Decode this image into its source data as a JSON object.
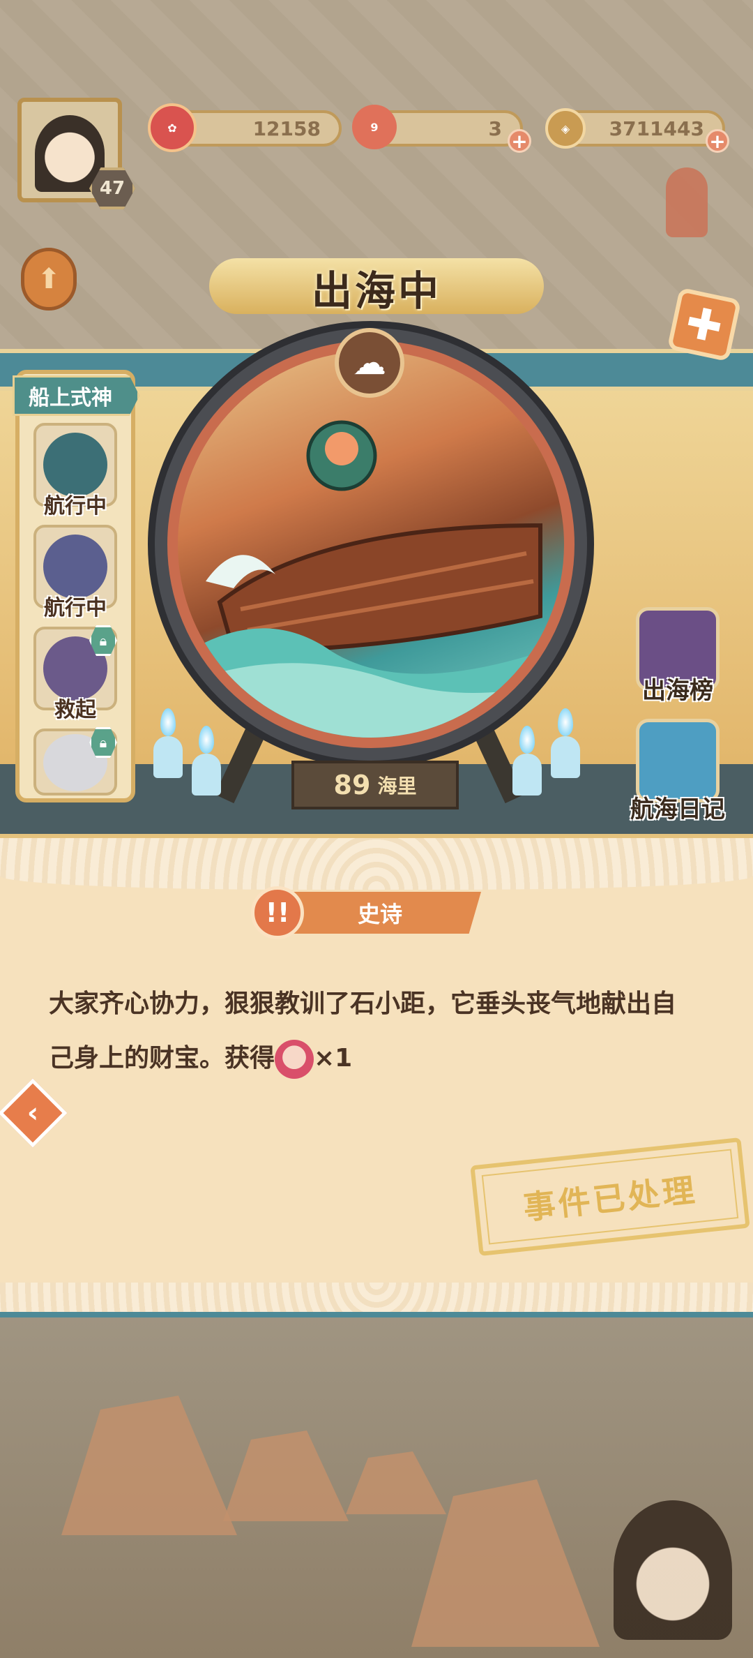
{
  "player": {
    "level": "47",
    "currency_1": "12158",
    "currency_2": "3",
    "currency_3": "3711443"
  },
  "title": "出海中",
  "crew": {
    "header": "船上式神",
    "members": [
      {
        "status": "航行中",
        "color": "#3c6f76"
      },
      {
        "status": "航行中",
        "color": "#5b5f8f"
      },
      {
        "status": "救起",
        "color": "#6b5a8a"
      },
      {
        "status": "",
        "color": "#d8d8dc"
      }
    ]
  },
  "distance": {
    "value": "89",
    "unit": "海里"
  },
  "side_buttons": {
    "leaderboard": "出海榜",
    "log": "航海日记"
  },
  "event": {
    "rarity": "史诗",
    "text_line1": "大家齐心协力，狠狠教训了石小距，它垂头丧气地献出自",
    "text_line2_prefix": "己身上的财宝。获得",
    "reward_count": "×1",
    "status_stamp": "事件已处理"
  },
  "colors": {
    "accent": "#e28a4d",
    "teal": "#4d8a97",
    "gold": "#d6ae64"
  },
  "icons": {
    "weather": "storm-cloud-icon",
    "close": "close-icon",
    "back": "back-arrow-icon"
  }
}
